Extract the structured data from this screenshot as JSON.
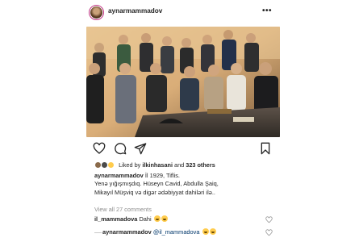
{
  "header": {
    "username": "aynarmammadov",
    "more_label": "•••"
  },
  "post": {
    "likes_prefix": "Liked by ",
    "likes_user": "ilkinhasani",
    "likes_middle": " and ",
    "likes_count": "323 others",
    "caption_user": "aynarmammadov",
    "caption_line1": " İl 1929, Tiflis.",
    "caption_line2": "Yenə yığışmışdıq. Hüseyn Cavid, Abdulla Şaiq,",
    "caption_line3": "Mikayıl Müşviq və digər ədəbiyyat dahiləri ilə..",
    "view_all": "View all 27 comments"
  },
  "comments": [
    {
      "user": "il_mammadova",
      "text": " Dahi "
    },
    {
      "user": "aynarmammadov",
      "mention": " @il_mammadova",
      "text": " "
    }
  ],
  "colors": {
    "text": "#262626",
    "muted": "#8e8e8e",
    "mention": "#00376b",
    "story_ring": "#c13584"
  }
}
